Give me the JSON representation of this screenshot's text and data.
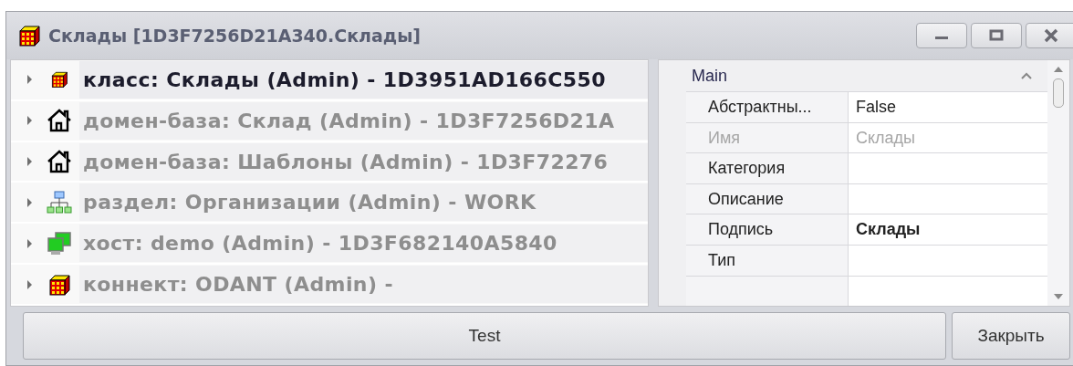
{
  "window": {
    "title": "Склады [1D3F7256D21A340.Склады]"
  },
  "tree": {
    "items": [
      {
        "kind": "class",
        "label": "класс: Склады (Admin) - 1D3951AD166C550",
        "selected": true
      },
      {
        "kind": "domain",
        "label": "домен-база: Склад (Admin) - 1D3F7256D21A",
        "selected": false
      },
      {
        "kind": "domain",
        "label": "домен-база: Шаблоны (Admin) - 1D3F72276",
        "selected": false
      },
      {
        "kind": "section",
        "label": "раздел: Организации (Admin) - WORK",
        "selected": false
      },
      {
        "kind": "host",
        "label": "хост: demo (Admin) - 1D3F682140A5840",
        "selected": false
      },
      {
        "kind": "connect",
        "label": "коннект: ODANT (Admin) -",
        "selected": false
      }
    ]
  },
  "properties": {
    "category": "Main",
    "expanded": true,
    "rows": [
      {
        "name": "Абстрактны...",
        "value": "False",
        "readonly": false,
        "modified": false
      },
      {
        "name": "Имя",
        "value": "Склады",
        "readonly": true,
        "modified": false
      },
      {
        "name": "Категория",
        "readonly": false,
        "modified": false
      },
      {
        "name": "Описание",
        "readonly": false,
        "modified": false
      },
      {
        "name": "Подпись",
        "value": "Склады",
        "readonly": false,
        "modified": true
      },
      {
        "name": "Тип",
        "readonly": false,
        "modified": false
      }
    ]
  },
  "buttons": [
    "Test",
    "Закрыть"
  ]
}
